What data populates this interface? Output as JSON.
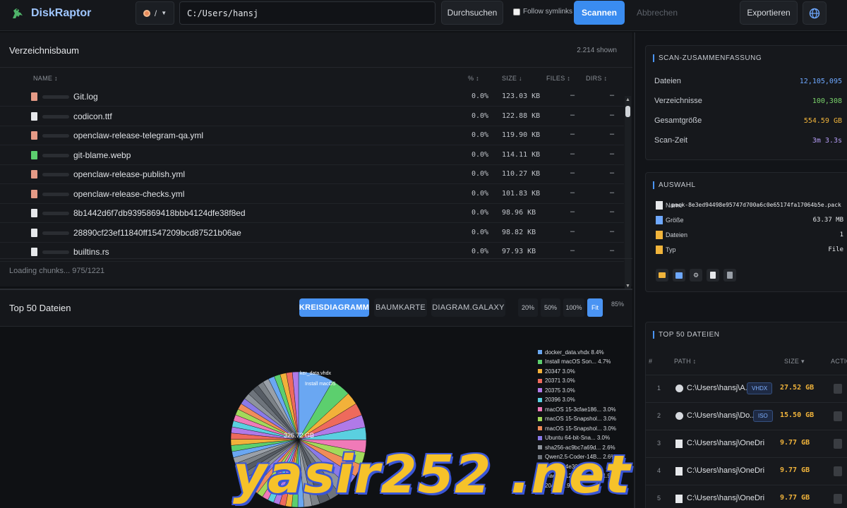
{
  "app": {
    "title": "DiskRaptor"
  },
  "toolbar": {
    "drive_label": "/",
    "path_value": "C:/Users/hansj",
    "browse_label": "Durchsuchen",
    "follow_symlinks_label": "Follow symlinks",
    "scan_label": "Scannen",
    "cancel_label": "Abbrechen",
    "export_label": "Exportieren"
  },
  "tree": {
    "title": "Verzeichnisbaum",
    "shown": "2.214 shown",
    "columns": {
      "name": "NAME",
      "pct": "%",
      "size": "SIZE",
      "files": "FILES",
      "dirs": "DIRS"
    },
    "rows": [
      {
        "name": "Git.log",
        "pct": "0.0%",
        "size": "123.03 KB",
        "files": "–",
        "dirs": "–",
        "icon": "text-file-icon"
      },
      {
        "name": "codicon.ttf",
        "pct": "0.0%",
        "size": "122.88 KB",
        "files": "–",
        "dirs": "–",
        "icon": "file-icon"
      },
      {
        "name": "openclaw-release-telegram-qa.yml",
        "pct": "0.0%",
        "size": "119.90 KB",
        "files": "–",
        "dirs": "–",
        "icon": "text-file-icon"
      },
      {
        "name": "git-blame.webp",
        "pct": "0.0%",
        "size": "114.11 KB",
        "files": "–",
        "dirs": "–",
        "icon": "image-file-icon"
      },
      {
        "name": "openclaw-release-publish.yml",
        "pct": "0.0%",
        "size": "110.27 KB",
        "files": "–",
        "dirs": "–",
        "icon": "text-file-icon"
      },
      {
        "name": "openclaw-release-checks.yml",
        "pct": "0.0%",
        "size": "101.83 KB",
        "files": "–",
        "dirs": "–",
        "icon": "text-file-icon"
      },
      {
        "name": "8b1442d6f7db9395869418bbb4124dfe38f8ed",
        "pct": "0.0%",
        "size": "98.96 KB",
        "files": "–",
        "dirs": "–",
        "icon": "file-icon"
      },
      {
        "name": "28890cf23ef11840ff1547209bcd87521b06ae",
        "pct": "0.0%",
        "size": "98.82 KB",
        "files": "–",
        "dirs": "–",
        "icon": "file-icon"
      },
      {
        "name": "builtins.rs",
        "pct": "0.0%",
        "size": "97.93 KB",
        "files": "–",
        "dirs": "–",
        "icon": "file-icon"
      }
    ],
    "loading": "Loading chunks... 975/1221"
  },
  "chart": {
    "title": "Top 50 Dateien",
    "tabs": [
      "KREISDIAGRAMM",
      "BAUMKARTE",
      "DIAGRAM.GALAXY"
    ],
    "active_tab": "KREISDIAGRAMM",
    "zoom_options": [
      "20%",
      "50%",
      "100%",
      "Fit"
    ],
    "active_zoom": "Fit",
    "zoom_level": "85%",
    "center_label": "326.72 GB",
    "slice_labels": [
      "ker_data.vhdx",
      "Install macOS"
    ],
    "legend": [
      {
        "label": "docker_data.vhdx 8.4%",
        "color": "#6aa7f2"
      },
      {
        "label": "Install macOS Son... 4.7%",
        "color": "#5ccf6e"
      },
      {
        "label": "20347 3.0%",
        "color": "#f2b13a"
      },
      {
        "label": "20371 3.0%",
        "color": "#ee6a5c"
      },
      {
        "label": "20375 3.0%",
        "color": "#b07ae8"
      },
      {
        "label": "20396 3.0%",
        "color": "#5ad0e0"
      },
      {
        "label": "macOS 15-3cfae186... 3.0%",
        "color": "#f07ab8"
      },
      {
        "label": "macOS 15-Snapshol... 3.0%",
        "color": "#a3d95a"
      },
      {
        "label": "macOS 15-Snapshol... 3.0%",
        "color": "#f08c5a"
      },
      {
        "label": "Ubuntu 64-bit-Sna... 3.0%",
        "color": "#8a7ae8"
      },
      {
        "label": "sha256-ac9bc7a69d... 2.6%",
        "color": "#8e949c"
      },
      {
        "label": "Qwen2.5-Coder-14B... 2.6%",
        "color": "#6e747c"
      },
      {
        "label": "sha256-4e30e2665...",
        "color": "#565c64"
      },
      {
        "label": "macOS 12-5b05.vmdk 1.9%",
        "color": "#7c8288"
      },
      {
        "label": "20452 1.9%",
        "color": "#9aa0a8"
      }
    ]
  },
  "chart_data": {
    "type": "pie",
    "title": "Top 50 Dateien",
    "total_label": "326.72 GB",
    "categories": [
      "docker_data.vhdx",
      "Install macOS Son...",
      "20347",
      "20371",
      "20375",
      "20396",
      "macOS 15-3cfae186...",
      "macOS 15-Snapshol...",
      "macOS 15-Snapshol...",
      "Ubuntu 64-bit-Sna...",
      "sha256-ac9bc7a69d...",
      "Qwen2.5-Coder-14B...",
      "sha256-4e30e2665...",
      "macOS 12-5b05.vmdk",
      "20452"
    ],
    "values": [
      8.4,
      4.7,
      3.0,
      3.0,
      3.0,
      3.0,
      3.0,
      3.0,
      3.0,
      3.0,
      2.6,
      2.6,
      2.6,
      1.9,
      1.9
    ],
    "unit": "%",
    "legend_position": "right"
  },
  "summary": {
    "title": "SCAN-ZUSAMMENFASSUNG",
    "items": [
      {
        "label": "Dateien",
        "value": "12,105,095",
        "color": "#6ea8ff"
      },
      {
        "label": "Verzeichnisse",
        "value": "100,308",
        "color": "#7ad36b"
      },
      {
        "label": "Gesamtgröße",
        "value": "554.59 GB",
        "color": "#f1b43b"
      },
      {
        "label": "Scan-Zeit",
        "value": "3m 3.3s",
        "color": "#b49cf5"
      }
    ]
  },
  "selection": {
    "title": "AUSWAHL",
    "items": [
      {
        "label": "Name",
        "value": "pack-8e3ed94498e95747d700a6c0e65174fa17064b5e.pack",
        "icon": "file-icon"
      },
      {
        "label": "Größe",
        "value": "63.37 MB",
        "icon": "disk-icon"
      },
      {
        "label": "Dateien",
        "value": "1",
        "icon": "folder-icon"
      },
      {
        "label": "Typ",
        "value": "File",
        "icon": "tag-icon"
      }
    ]
  },
  "top50": {
    "title": "TOP 50 DATEIEN",
    "columns": {
      "idx": "#",
      "path": "PATH",
      "size": "SIZE",
      "action": "ACTIO"
    },
    "rows": [
      {
        "idx": "1",
        "path": "C:\\Users\\hansj\\A...",
        "tag": "VHDX",
        "size": "27.52 GB",
        "icon": "disc-icon"
      },
      {
        "idx": "2",
        "path": "C:\\Users\\hansj\\Do...",
        "tag": "ISO",
        "size": "15.50 GB",
        "icon": "disc-icon"
      },
      {
        "idx": "3",
        "path": "C:\\Users\\hansj\\OneDrive\\...",
        "tag": "",
        "size": "9.77 GB",
        "icon": "file-icon"
      },
      {
        "idx": "4",
        "path": "C:\\Users\\hansj\\OneDrive\\...",
        "tag": "",
        "size": "9.77 GB",
        "icon": "file-icon"
      },
      {
        "idx": "5",
        "path": "C:\\Users\\hansj\\OneDrive\\...",
        "tag": "",
        "size": "9.77 GB",
        "icon": "file-icon"
      }
    ]
  },
  "watermark": "yasir252 .net"
}
